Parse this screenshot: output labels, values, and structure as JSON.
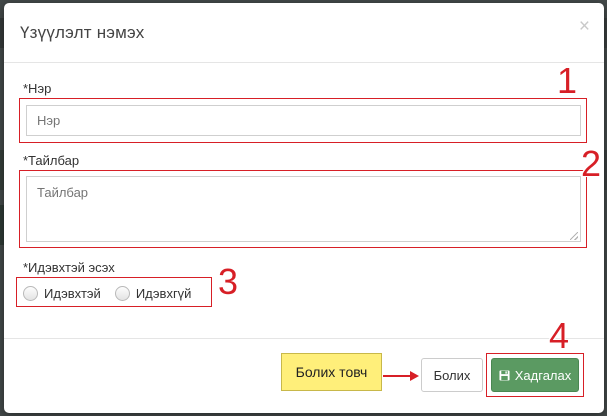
{
  "modal": {
    "title": "Үзүүлэлт нэмэх",
    "close_glyph": "×"
  },
  "fields": {
    "name": {
      "label": "*Нэр",
      "placeholder": "Нэр",
      "value": ""
    },
    "description": {
      "label": "*Тайлбар",
      "placeholder": "Тайлбар",
      "value": ""
    },
    "active": {
      "label": "*Идэвхтэй эсэх",
      "options": [
        {
          "label": "Идэвхтэй",
          "selected": false
        },
        {
          "label": "Идэвхгүй",
          "selected": false
        }
      ]
    }
  },
  "annotations": {
    "numbers": [
      "1",
      "2",
      "3",
      "4"
    ],
    "callout_text": "Болих товч",
    "color": "#d71f26",
    "callout_color": "#ffef7a"
  },
  "footer": {
    "cancel_label": "Болих",
    "save_label": "Хадгалах",
    "save_icon": "floppy-disk-icon",
    "save_color": "#5b9a62"
  }
}
